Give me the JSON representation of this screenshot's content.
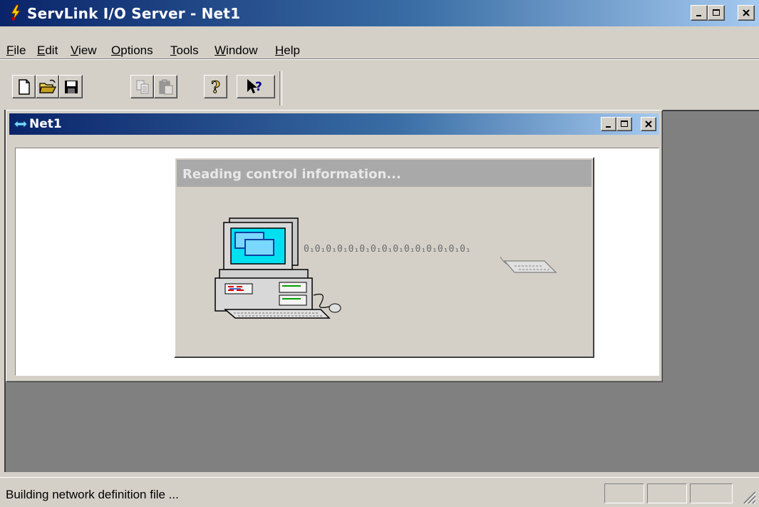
{
  "app": {
    "title": "ServLink I/O Server - Net1"
  },
  "menu": [
    {
      "label": "File",
      "key": "F",
      "rest": "ile"
    },
    {
      "label": "Edit",
      "key": "E",
      "rest": "dit"
    },
    {
      "label": "View",
      "key": "V",
      "rest": "iew"
    },
    {
      "label": "Options",
      "key": "O",
      "rest": "ptions"
    },
    {
      "label": "Tools",
      "key": "T",
      "rest": "ools"
    },
    {
      "label": "Window",
      "key": "W",
      "rest": "indow"
    },
    {
      "label": "Help",
      "key": "H",
      "rest": "elp"
    }
  ],
  "toolbar": {
    "buttons": [
      {
        "name": "new-document-icon",
        "enabled": true
      },
      {
        "name": "open-folder-icon",
        "enabled": true
      },
      {
        "name": "save-floppy-icon",
        "enabled": true
      },
      {
        "name": "copy-icon",
        "enabled": false
      },
      {
        "name": "paste-icon",
        "enabled": false
      },
      {
        "name": "help-icon",
        "enabled": true
      },
      {
        "name": "context-help-icon",
        "enabled": true
      }
    ]
  },
  "child_window": {
    "title": "Net1"
  },
  "dialog": {
    "title": "Reading control information...",
    "bits": "0₁0₁0₁0₁0₁0₁0₁0₁0₁0₁0₁0₁0₁0₁0₁"
  },
  "status": {
    "text": "Building network definition file ..."
  },
  "colors": {
    "active_title_start": "#0a246a",
    "active_title_end": "#a6caf0",
    "face": "#d4d0c8",
    "mdi_background": "#808080"
  }
}
